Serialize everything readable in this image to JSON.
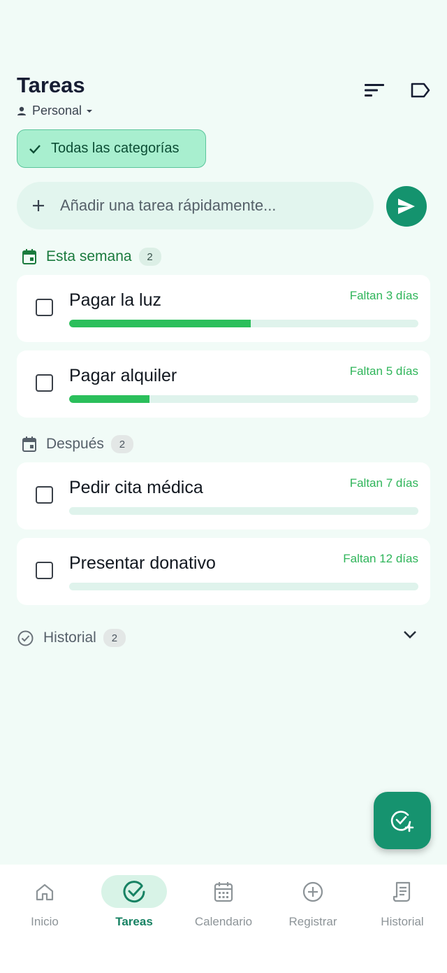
{
  "header": {
    "title": "Tareas",
    "profile": "Personal",
    "sort_icon": "sort-icon",
    "tag_icon": "label-icon"
  },
  "filter_chip": {
    "label": "Todas las categorías",
    "icon": "check-icon"
  },
  "quick_add": {
    "placeholder": "Añadir una tarea rápidamente...",
    "plus_icon": "plus-icon",
    "send_icon": "send-icon"
  },
  "sections": {
    "this_week": {
      "label": "Esta semana",
      "count": "2",
      "icon": "calendar-icon"
    },
    "later": {
      "label": "Después",
      "count": "2",
      "icon": "calendar-icon"
    },
    "history": {
      "label": "Historial",
      "count": "2",
      "icon": "check-circle-icon"
    }
  },
  "tasks": [
    {
      "name": "Pagar la luz",
      "due": "Faltan 3 días",
      "progress": 0.52
    },
    {
      "name": "Pagar alquiler",
      "due": "Faltan 5 días",
      "progress": 0.23
    },
    {
      "name": "Pedir cita médica",
      "due": "Faltan 7 días",
      "progress": 0
    },
    {
      "name": "Presentar donativo",
      "due": "Faltan 12 días",
      "progress": 0
    }
  ],
  "nav": [
    {
      "label": "Inicio",
      "icon": "home-icon",
      "active": false
    },
    {
      "label": "Tareas",
      "icon": "task-check-icon",
      "active": true
    },
    {
      "label": "Calendario",
      "icon": "calendar-icon",
      "active": false
    },
    {
      "label": "Registrar",
      "icon": "add-circle-icon",
      "active": false
    },
    {
      "label": "Historial",
      "icon": "receipt-icon",
      "active": false
    }
  ],
  "colors": {
    "accent": "#14936e",
    "progress": "#2bbf5b",
    "due": "#2fb55a",
    "background": "#f1fbf7"
  }
}
